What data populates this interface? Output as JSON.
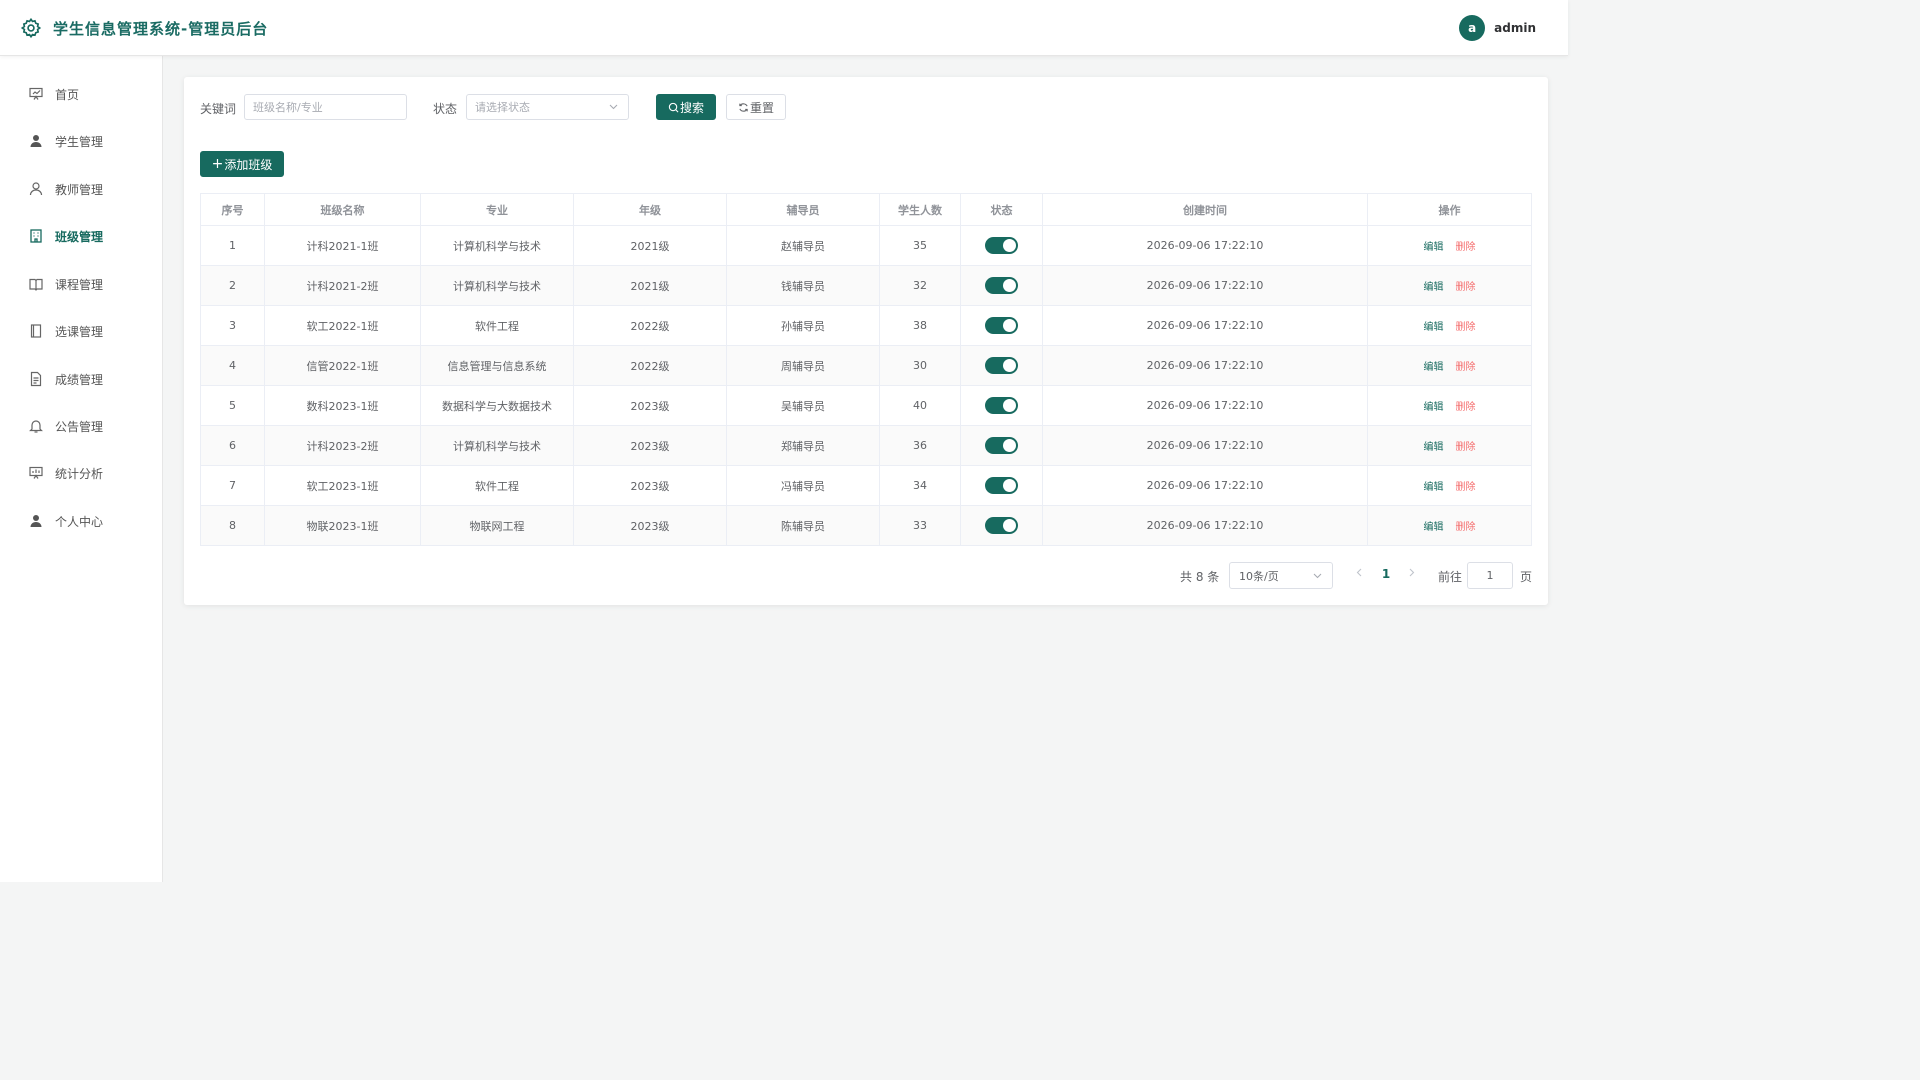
{
  "header": {
    "title": "学生信息管理系统-管理员后台",
    "avatar_letter": "a",
    "username": "admin",
    "accent_color": "#176a5f"
  },
  "sidebar": {
    "items": [
      {
        "label": "首页",
        "icon": "chart-board-icon",
        "active": false
      },
      {
        "label": "学生管理",
        "icon": "user-filled-icon",
        "active": false
      },
      {
        "label": "教师管理",
        "icon": "user-outline-icon",
        "active": false
      },
      {
        "label": "班级管理",
        "icon": "building-icon",
        "active": true
      },
      {
        "label": "课程管理",
        "icon": "book-open-icon",
        "active": false
      },
      {
        "label": "选课管理",
        "icon": "notebook-icon",
        "active": false
      },
      {
        "label": "成绩管理",
        "icon": "document-icon",
        "active": false
      },
      {
        "label": "公告管理",
        "icon": "bell-icon",
        "active": false
      },
      {
        "label": "统计分析",
        "icon": "data-board-icon",
        "active": false
      },
      {
        "label": "个人中心",
        "icon": "user-filled-icon",
        "active": false
      }
    ]
  },
  "search": {
    "keyword_label": "关键词",
    "keyword_placeholder": "班级名称/专业",
    "status_label": "状态",
    "status_placeholder": "请选择状态",
    "search_button": "搜索",
    "reset_button": "重置"
  },
  "toolbar": {
    "add_button": "添加班级"
  },
  "table": {
    "headers": [
      "序号",
      "班级名称",
      "专业",
      "年级",
      "辅导员",
      "学生人数",
      "状态",
      "创建时间",
      "操作"
    ],
    "edit_label": "编辑",
    "delete_label": "删除",
    "rows": [
      {
        "index": "1",
        "name": "计科2021-1班",
        "major": "计算机科学与技术",
        "grade": "2021级",
        "counselor": "赵辅导员",
        "count": "35",
        "enabled": true,
        "created": "2026-09-06 17:22:10"
      },
      {
        "index": "2",
        "name": "计科2021-2班",
        "major": "计算机科学与技术",
        "grade": "2021级",
        "counselor": "钱辅导员",
        "count": "32",
        "enabled": true,
        "created": "2026-09-06 17:22:10"
      },
      {
        "index": "3",
        "name": "软工2022-1班",
        "major": "软件工程",
        "grade": "2022级",
        "counselor": "孙辅导员",
        "count": "38",
        "enabled": true,
        "created": "2026-09-06 17:22:10"
      },
      {
        "index": "4",
        "name": "信管2022-1班",
        "major": "信息管理与信息系统",
        "grade": "2022级",
        "counselor": "周辅导员",
        "count": "30",
        "enabled": true,
        "created": "2026-09-06 17:22:10"
      },
      {
        "index": "5",
        "name": "数科2023-1班",
        "major": "数据科学与大数据技术",
        "grade": "2023级",
        "counselor": "吴辅导员",
        "count": "40",
        "enabled": true,
        "created": "2026-09-06 17:22:10"
      },
      {
        "index": "6",
        "name": "计科2023-2班",
        "major": "计算机科学与技术",
        "grade": "2023级",
        "counselor": "郑辅导员",
        "count": "36",
        "enabled": true,
        "created": "2026-09-06 17:22:10"
      },
      {
        "index": "7",
        "name": "软工2023-1班",
        "major": "软件工程",
        "grade": "2023级",
        "counselor": "冯辅导员",
        "count": "34",
        "enabled": true,
        "created": "2026-09-06 17:22:10"
      },
      {
        "index": "8",
        "name": "物联2023-1班",
        "major": "物联网工程",
        "grade": "2023级",
        "counselor": "陈辅导员",
        "count": "33",
        "enabled": true,
        "created": "2026-09-06 17:22:10"
      }
    ]
  },
  "pagination": {
    "total_text": "共 8 条",
    "page_size": "10条/页",
    "current_page": "1",
    "goto_label": "前往",
    "goto_value": "1",
    "page_unit": "页"
  }
}
